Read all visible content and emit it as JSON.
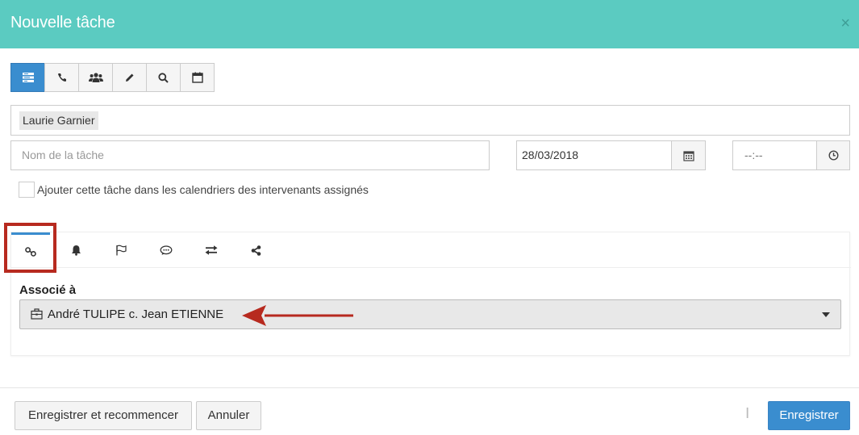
{
  "header": {
    "title": "Nouvelle tâche",
    "close_label": "×",
    "bg_color": "#5bcbc1"
  },
  "task_types": [
    {
      "icon": "list-icon",
      "active": true
    },
    {
      "icon": "phone-icon",
      "active": false
    },
    {
      "icon": "group-icon",
      "active": false
    },
    {
      "icon": "pencil-icon",
      "active": false
    },
    {
      "icon": "search-icon",
      "active": false
    },
    {
      "icon": "calendar-icon",
      "active": false
    }
  ],
  "assignee": {
    "name": "Laurie Garnier"
  },
  "task_name": {
    "placeholder": "Nom de la tâche",
    "value": ""
  },
  "date": {
    "value": "28/03/2018"
  },
  "time": {
    "value": "--:--"
  },
  "add_to_calendars": {
    "label": "Ajouter cette tâche dans les calendriers des intervenants assignés",
    "checked": false
  },
  "tabs": [
    {
      "icon": "link-icon",
      "active": true
    },
    {
      "icon": "bell-icon",
      "active": false
    },
    {
      "icon": "flag-icon",
      "active": false
    },
    {
      "icon": "comment-icon",
      "active": false
    },
    {
      "icon": "exchange-icon",
      "active": false
    },
    {
      "icon": "share-icon",
      "active": false
    }
  ],
  "associated": {
    "label": "Associé à",
    "value": "André TULIPE c. Jean ETIENNE",
    "icon": "briefcase-icon"
  },
  "footer": {
    "save_restart_label": "Enregistrer et recommencer",
    "cancel_label": "Annuler",
    "save_label": "Enregistrer"
  },
  "colors": {
    "accent": "#3a8dcf",
    "annotation": "#b72a1f"
  }
}
